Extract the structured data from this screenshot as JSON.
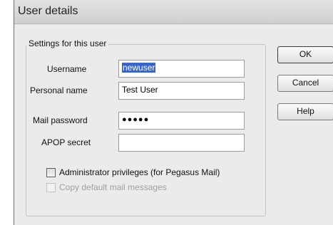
{
  "window": {
    "title": "User details"
  },
  "group": {
    "legend": "Settings for this user"
  },
  "fields": {
    "username": {
      "label": "Username",
      "value": "newuser"
    },
    "personal_name": {
      "label": "Personal name",
      "value": "Test User"
    },
    "mail_password": {
      "label": "Mail password",
      "value": "●●●●●"
    },
    "apop_secret": {
      "label": "APOP secret",
      "value": ""
    }
  },
  "checkboxes": {
    "admin": {
      "label": "Administrator privileges (for Pegasus Mail)",
      "checked": false,
      "enabled": true
    },
    "copy_default": {
      "label": "Copy default mail messages",
      "checked": false,
      "enabled": false
    }
  },
  "buttons": {
    "ok": "OK",
    "cancel": "Cancel",
    "help": "Help"
  }
}
